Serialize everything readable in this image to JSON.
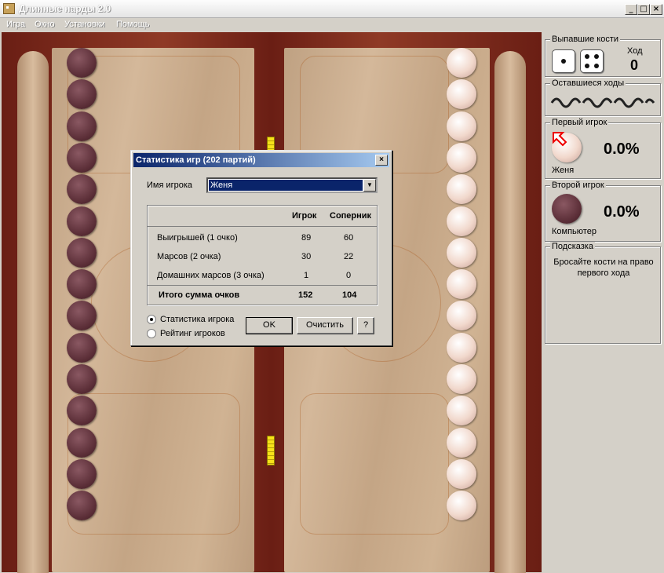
{
  "window": {
    "title": "Длинные нарды 2.0",
    "min": "_",
    "max": "□",
    "close": "×"
  },
  "menu": [
    "Игра",
    "Окно",
    "Установки",
    "Помощь"
  ],
  "side": {
    "dice_label": "Выпавшие кости",
    "dice": [
      1,
      4
    ],
    "move_label": "Ход",
    "move_value": "0",
    "remaining_label": "Оставшиеся ходы",
    "p1_label": "Первый игрок",
    "p1_pct": "0.0%",
    "p1_name": "Женя",
    "p2_label": "Второй игрок",
    "p2_pct": "0.0%",
    "p2_name": "Компьютер",
    "hint_label": "Подсказка",
    "hint_text": "Бросайте кости на право первого хода"
  },
  "dialog": {
    "title": "Статистика игр (202 партий)",
    "close": "×",
    "player_label": "Имя игрока",
    "player_value": "Женя",
    "headers": {
      "player": "Игрок",
      "opponent": "Соперник"
    },
    "rows": [
      {
        "label": "Выигрышей (1 очко)",
        "player": "89",
        "opponent": "60"
      },
      {
        "label": "Марсов (2 очка)",
        "player": "30",
        "opponent": "22"
      },
      {
        "label": "Домашних марсов (3 очка)",
        "player": "1",
        "opponent": "0"
      }
    ],
    "total": {
      "label": "Итого сумма очков",
      "player": "152",
      "opponent": "104"
    },
    "radio1": "Статистика игрока",
    "radio2": "Рейтинг игроков",
    "ok": "OK",
    "clear": "Очистить",
    "help": "?"
  },
  "colors": {
    "dark_checker": "#5b2e37",
    "light_checker": "#f1d8cc",
    "board_frame": "#8f3a26",
    "title_active": "#0a246a"
  }
}
